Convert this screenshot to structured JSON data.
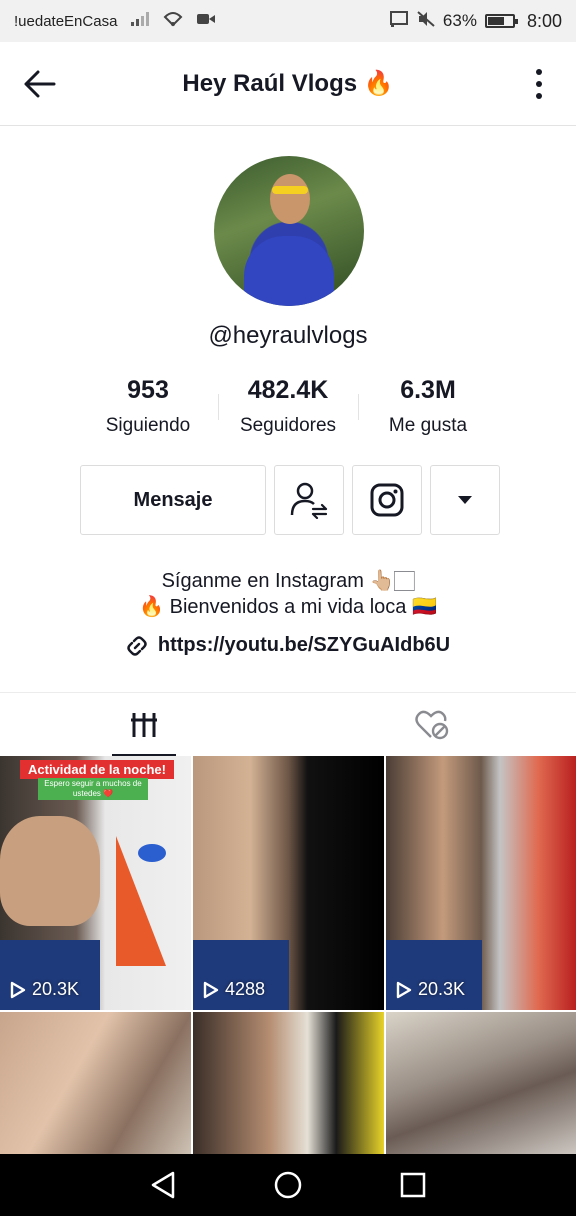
{
  "status_bar": {
    "app_name": "!uedateEnCasa",
    "battery_percent": "63%",
    "battery_level": 0.63,
    "time": "8:00"
  },
  "header": {
    "title": "Hey Raúl Vlogs 🔥",
    "back_icon": "arrow-left-icon",
    "more_icon": "more-vertical-icon"
  },
  "profile": {
    "username": "@heyraulvlogs",
    "stats": [
      {
        "value": "953",
        "label": "Siguiendo"
      },
      {
        "value": "482.4K",
        "label": "Seguidores"
      },
      {
        "value": "6.3M",
        "label": "Me gusta"
      }
    ],
    "actions": {
      "message_label": "Mensaje",
      "follow_icon": "user-swap-icon",
      "instagram_icon": "instagram-icon",
      "dropdown_icon": "caret-down-icon"
    },
    "bio_line1": "Síganme en Instagram 👆🏼🏻",
    "bio_line2": "🔥 Bienvenidos a mi vida loca 🇨🇴",
    "link": "https://youtu.be/SZYGuAIdb6U"
  },
  "tabs": [
    {
      "name": "videos",
      "icon": "grid-icon",
      "active": true
    },
    {
      "name": "liked",
      "icon": "hidden-heart-icon",
      "active": false
    }
  ],
  "videos": [
    {
      "views": "20.3K",
      "overlay_title": "Actividad de la noche!",
      "overlay_sub": "Espero seguir a muchos de ustedes ❤️"
    },
    {
      "views": "4288"
    },
    {
      "views": "20.3K"
    },
    {
      "views": ""
    },
    {
      "views": ""
    },
    {
      "views": ""
    }
  ],
  "navbar": {
    "back_icon": "triangle-back-icon",
    "home_icon": "circle-home-icon",
    "recents_icon": "square-recents-icon"
  },
  "colors": {
    "text": "#161823",
    "overlay_red": "#e23030",
    "navbar": "#000000"
  }
}
